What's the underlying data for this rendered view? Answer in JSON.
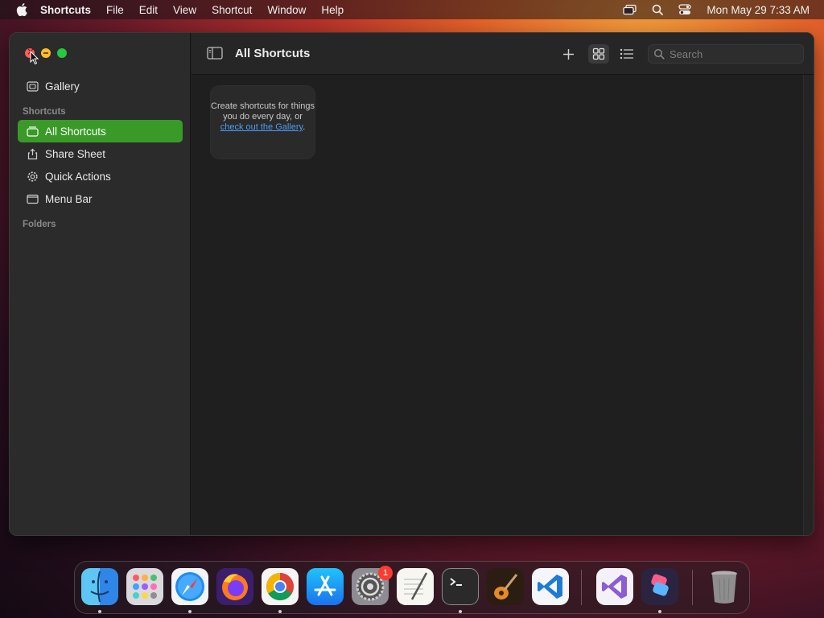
{
  "menubar": {
    "app_name": "Shortcuts",
    "menus": [
      "File",
      "Edit",
      "View",
      "Shortcut",
      "Window",
      "Help"
    ],
    "clock": "Mon May 29  7:33 AM"
  },
  "sidebar": {
    "gallery_label": "Gallery",
    "section_shortcuts": "Shortcuts",
    "items": [
      {
        "label": "All Shortcuts",
        "icon": "stack-icon",
        "active": true
      },
      {
        "label": "Share Sheet",
        "icon": "share-icon",
        "active": false
      },
      {
        "label": "Quick Actions",
        "icon": "gear-icon",
        "active": false
      },
      {
        "label": "Menu Bar",
        "icon": "menubar-icon",
        "active": false
      }
    ],
    "section_folders": "Folders"
  },
  "toolbar": {
    "title": "All Shortcuts",
    "search_placeholder": "Search"
  },
  "empty_state": {
    "text_before": "Create shortcuts for things you do every day, or ",
    "link_text": "check out the Gallery",
    "text_after": "."
  },
  "dock": {
    "apps": [
      "Finder",
      "Launchpad",
      "Safari",
      "Firefox",
      "Google Chrome",
      "App Store",
      "System Settings",
      "TextEdit",
      "Terminal",
      "GarageBand",
      "Visual Studio Code",
      "Visual Studio",
      "Shortcuts",
      "Trash"
    ],
    "settings_badge": "1"
  },
  "colors": {
    "accent_green": "#3a9a28",
    "link_blue": "#4a9df8"
  }
}
